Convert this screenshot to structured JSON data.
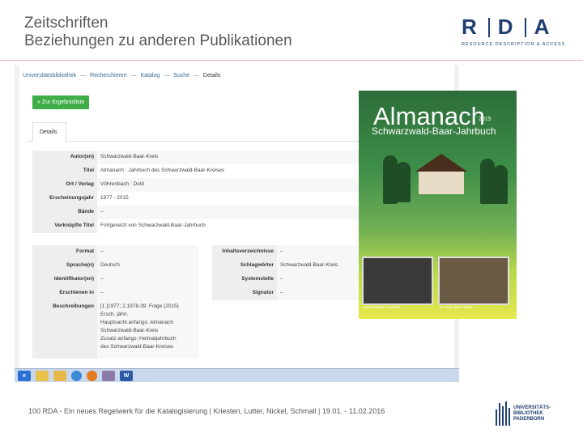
{
  "slide": {
    "title_line1": "Zeitschriften",
    "title_line2": "Beziehungen zu anderen Publikationen",
    "logo_letters": [
      "R",
      "D",
      "A"
    ],
    "logo_subtitle": "RESOURCE DESCRIPTION & ACCESS",
    "footer": "100 RDA - Ein neues Regelwerk für die Katalogisierung | Kriesten, Lutter, Nickel, Schmall | 19.01. - 11.02.2016",
    "uni_logo_line1": "UNIVERSITÄTS-",
    "uni_logo_line2": "BIBLIOTHEK",
    "uni_logo_line3": "PADERBORN"
  },
  "catalog": {
    "breadcrumb": [
      "Universitätsbibliothek",
      "Recherchieren",
      "Katalog",
      "Suche",
      "Details"
    ],
    "breadcrumb_sep": "—",
    "back_button": "« Zur Ergebnisliste",
    "tab_details": "Details",
    "fields": [
      {
        "label": "Autor(en)",
        "value": "Schwarzwald-Baar-Kreis"
      },
      {
        "label": "Titel",
        "value": "Almanach : Jahrbuch des Schwarzwald-Baar-Kreises"
      },
      {
        "label": "Ort / Verlag",
        "value": "Vöhrenbach : Dold"
      },
      {
        "label": "Erscheinungsjahr",
        "value": "1977 - 2015"
      },
      {
        "label": "Bände",
        "value": "–"
      },
      {
        "label": "Verknüpfte Titel",
        "value": "Fortgesetzt von Schwarzwald-Baar-Jahrbuch"
      }
    ],
    "left_fields": [
      {
        "label": "Format",
        "value": "–"
      },
      {
        "label": "Sprache(n)",
        "value": "Deutsch"
      },
      {
        "label": "Identifikator(en)",
        "value": "–"
      },
      {
        "label": "Erschienen in",
        "value": "–"
      }
    ],
    "right_fields": [
      {
        "label": "Inhaltsverzeichnisse",
        "value": "–"
      },
      {
        "label": "Schlagwörter",
        "value": "Schwarzwald-Baar-Kreis"
      },
      {
        "label": "Systemstelle",
        "value": "–"
      },
      {
        "label": "Signatur",
        "value": "–"
      }
    ],
    "description_label": "Beschreibungen",
    "description_lines": [
      "[1.]1977; 2.1978-39. Folge (2015)",
      "Ersch. jährl.",
      "Hauptsacht.anfangs: Almanach",
      "Schwarzwald-Baar-Kreis",
      "Zusatz anfangs: Heimatjahrbuch",
      "des Schwarzwald-Baar-Kreises"
    ]
  },
  "cover": {
    "title": "Almanach",
    "year": "2015",
    "subtitle": "Schwarzwald-Baar-Jahrbuch",
    "caption_left": "Schwarzwald „Gefühle\"",
    "caption_right": "Zu Gast „Die Falken\""
  },
  "taskbar": {
    "icons": [
      {
        "name": "ie-icon",
        "color": "#2a6fd4"
      },
      {
        "name": "folder-icon",
        "color": "#e9c24a"
      },
      {
        "name": "explorer-icon",
        "color": "#e8b84a"
      },
      {
        "name": "chrome-icon",
        "color": "#3a8ad6"
      },
      {
        "name": "firefox-icon",
        "color": "#e57a1f"
      },
      {
        "name": "marc-icon",
        "color": "#8a7aa8"
      },
      {
        "name": "word-icon",
        "color": "#2b5aa8"
      }
    ]
  }
}
